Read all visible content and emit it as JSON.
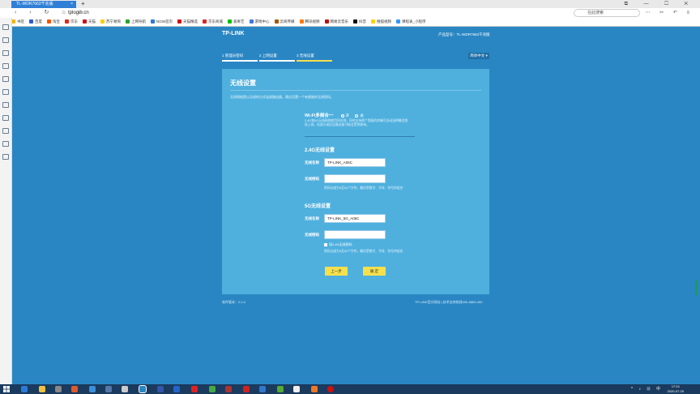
{
  "browser": {
    "tab_title": "TL-WDR7663千兆版",
    "new_tab": "+",
    "close": "×",
    "window_controls": "⧉ — ☐ ✕",
    "nav": "‹ › ↻ ⌂ ☆",
    "url": "tplogin.cn",
    "search_placeholder": "在此搜索",
    "addr_icons": "⋯ ✂ ↶ ≡"
  },
  "bookmarks": [
    {
      "label": "书签",
      "color": "#f5b400"
    },
    {
      "label": "百度",
      "color": "#2b5bd7"
    },
    {
      "label": "淘宝",
      "color": "#ff5000"
    },
    {
      "label": "京东",
      "color": "#e1251b"
    },
    {
      "label": "天猫",
      "color": "#d20a14"
    },
    {
      "label": "苏宁易购",
      "color": "#ffcc00"
    },
    {
      "label": "上网导航",
      "color": "#29a329"
    },
    {
      "label": "NGW首页",
      "color": "#2b7bd6"
    },
    {
      "label": "天猫精选",
      "color": "#d20a14"
    },
    {
      "label": "京东商城",
      "color": "#e1251b"
    },
    {
      "label": "爱奇艺",
      "color": "#00be06"
    },
    {
      "label": "游戏中心",
      "color": "#4477dd"
    },
    {
      "label": "云商传媒",
      "color": "#aa5500"
    },
    {
      "label": "腾讯视频",
      "color": "#ff7a00"
    },
    {
      "label": "网易云音乐",
      "color": "#c20c0c"
    },
    {
      "label": "抖音",
      "color": "#111111"
    },
    {
      "label": "搜狐视频",
      "color": "#ffd000"
    },
    {
      "label": "课程表_小程序",
      "color": "#3399ff"
    }
  ],
  "page": {
    "brand": "TP-LINK",
    "model": "产品型号：TL-WDR7663千兆版",
    "steps": [
      "1 管理员密码",
      "2 上网设置",
      "3 无线设置"
    ],
    "language": "简体中文 ▾",
    "panel_title": "无线设置",
    "panel_desc": "无线网络是以无线的方式连接路由器，建议设置一个有限制的无线密码。",
    "wifi_merge_label": "Wi-Fi多频合一",
    "wifi_merge_on": "开",
    "wifi_merge_off": "关",
    "wifi_merge_note": "2.4G和5G无线网络使用同名称，同时支持两个频段的终端可自动选择最优频段上网，但部分老旧设备连接可能会受到影响。",
    "section_24g": "2.4G无线设置",
    "ssid_label": "无线名称",
    "ssid_24g": "TP-LINK_A06C",
    "pwd_label": "无线密码",
    "pwd_24g": "",
    "pwd_hint": "密码长度为8至63个字符，最好是数字、字母、符号的组合",
    "section_5g": "5G无线设置",
    "ssid_5g": "TP-LINK_5G_A06C",
    "pwd_5g": "",
    "same_as_24g": "同2.4G无线密码",
    "btn_prev": "上一步",
    "btn_confirm": "确 定",
    "footer_version": "软件版本：2.0.4",
    "footer_links": "TP-LINK官方网站 | 技术支持热线400-8863-400"
  },
  "taskbar": {
    "time": "17:24",
    "date": "2020-07-25",
    "tray": "^ ♪ ⊡ 中"
  }
}
